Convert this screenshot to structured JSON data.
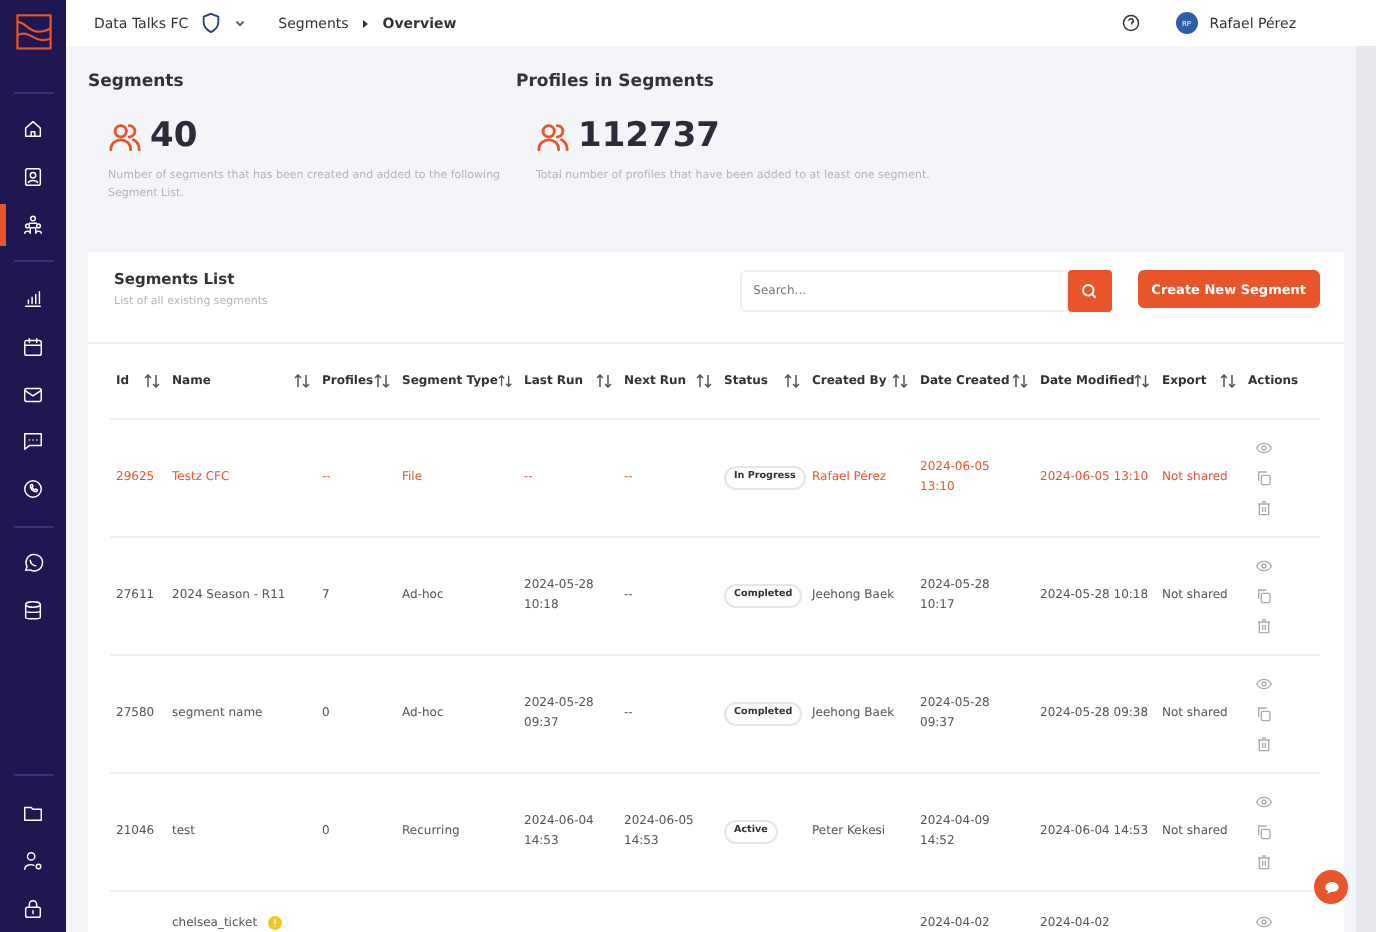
{
  "sidebar": {
    "items": [
      {
        "selected": false
      },
      {
        "selected": false
      },
      {
        "selected": true
      },
      {
        "selected": false
      },
      {
        "selected": false
      },
      {
        "selected": false
      },
      {
        "selected": false
      },
      {
        "selected": false
      },
      {
        "selected": false
      },
      {
        "selected": false
      },
      {
        "selected": false
      },
      {
        "selected": false
      },
      {
        "selected": false
      }
    ]
  },
  "topbar": {
    "club": "Data Talks FC",
    "breadcrumb": [
      "Segments",
      "Overview"
    ],
    "user_initials": "RP",
    "user_name": "Rafael Pérez"
  },
  "stats": [
    {
      "title": "Segments",
      "value": "40",
      "description": "Number of segments that has been created and added to the following Segment List."
    },
    {
      "title": "Profiles in Segments",
      "value": "112737",
      "description": "Total number of profiles that have been added to at least one segment."
    }
  ],
  "segments_list": {
    "title": "Segments List",
    "subtitle": "List of all existing segments",
    "search": {
      "placeholder": "Search..."
    },
    "create_button": "Create New Segment",
    "columns": [
      {
        "label": "Id",
        "sortable": true
      },
      {
        "label": "Name",
        "sortable": true
      },
      {
        "label": "Profiles",
        "sortable": true
      },
      {
        "label": "Segment Type",
        "sortable": true
      },
      {
        "label": "Last Run",
        "sortable": true
      },
      {
        "label": "Next Run",
        "sortable": true
      },
      {
        "label": "Status",
        "sortable": true
      },
      {
        "label": "Created By",
        "sortable": true
      },
      {
        "label": "Date Created",
        "sortable": true
      },
      {
        "label": "Date Modified",
        "sortable": true
      },
      {
        "label": "Export",
        "sortable": true
      },
      {
        "label": "Actions",
        "sortable": false
      }
    ],
    "rows": [
      {
        "id": "29625",
        "name": "Testz CFC",
        "warning": false,
        "profiles": "--",
        "type": "File",
        "last_run": "--",
        "next_run": "--",
        "status": "In Progress",
        "created_by": "Rafael Pérez",
        "date_created": "2024-06-05 13:10",
        "date_modified": "2024-06-05 13:10",
        "export": "Not shared",
        "highlighted": true
      },
      {
        "id": "27611",
        "name": "2024 Season - R11",
        "warning": false,
        "profiles": "7",
        "type": "Ad-hoc",
        "last_run": "2024-05-28 10:18",
        "next_run": "--",
        "status": "Completed",
        "created_by": "Jeehong Baek",
        "date_created": "2024-05-28 10:17",
        "date_modified": "2024-05-28 10:18",
        "export": "Not shared",
        "highlighted": false
      },
      {
        "id": "27580",
        "name": "segment name",
        "warning": false,
        "profiles": "0",
        "type": "Ad-hoc",
        "last_run": "2024-05-28 09:37",
        "next_run": "--",
        "status": "Completed",
        "created_by": "Jeehong Baek",
        "date_created": "2024-05-28 09:37",
        "date_modified": "2024-05-28 09:38",
        "export": "Not shared",
        "highlighted": false
      },
      {
        "id": "21046",
        "name": "test",
        "warning": false,
        "profiles": "0",
        "type": "Recurring",
        "last_run": "2024-06-04 14:53",
        "next_run": "2024-06-05 14:53",
        "status": "Active",
        "created_by": "Peter Kekesi",
        "date_created": "2024-04-09 14:52",
        "date_modified": "2024-06-04 14:53",
        "export": "Not shared",
        "highlighted": false
      },
      {
        "name": "chelsea_ticket",
        "warning": true,
        "date_created": "2024-04-02",
        "date_modified": "2024-04-02",
        "highlighted": false
      }
    ]
  }
}
